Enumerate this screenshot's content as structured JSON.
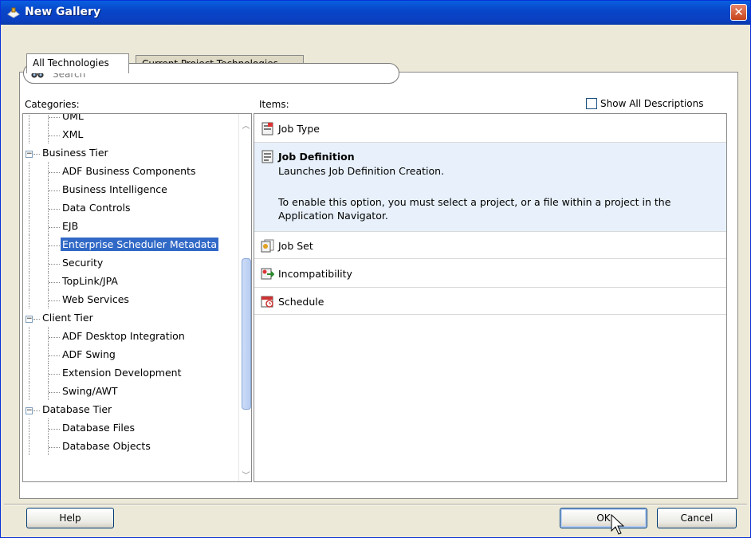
{
  "window": {
    "title": "New Gallery",
    "close_label": "✕"
  },
  "tabs": [
    {
      "label": "All Technologies",
      "active": true
    },
    {
      "label": "Current Project Technologies",
      "active": false
    }
  ],
  "search": {
    "placeholder": "Search",
    "value": ""
  },
  "categories": {
    "label": "Categories:",
    "items": [
      {
        "label": "UML",
        "level": 2,
        "partial": true
      },
      {
        "label": "XML",
        "level": 2
      },
      {
        "label": "Business Tier",
        "level": 1,
        "expanded": true
      },
      {
        "label": "ADF Business Components",
        "level": 2
      },
      {
        "label": "Business Intelligence",
        "level": 2
      },
      {
        "label": "Data Controls",
        "level": 2
      },
      {
        "label": "EJB",
        "level": 2
      },
      {
        "label": "Enterprise Scheduler Metadata",
        "level": 2,
        "selected": true
      },
      {
        "label": "Security",
        "level": 2
      },
      {
        "label": "TopLink/JPA",
        "level": 2
      },
      {
        "label": "Web Services",
        "level": 2
      },
      {
        "label": "Client Tier",
        "level": 1,
        "expanded": true
      },
      {
        "label": "ADF Desktop Integration",
        "level": 2
      },
      {
        "label": "ADF Swing",
        "level": 2
      },
      {
        "label": "Extension Development",
        "level": 2
      },
      {
        "label": "Swing/AWT",
        "level": 2
      },
      {
        "label": "Database Tier",
        "level": 1,
        "expanded": true
      },
      {
        "label": "Database Files",
        "level": 2
      },
      {
        "label": "Database Objects",
        "level": 2
      }
    ]
  },
  "items": {
    "label": "Items:",
    "show_all_label": "Show All Descriptions",
    "show_all_checked": false,
    "list": [
      {
        "label": "Job Type",
        "icon": "job-type-icon"
      },
      {
        "label": "Job Definition",
        "icon": "job-definition-icon",
        "expanded": true,
        "desc1": "Launches Job Definition Creation.",
        "desc2": "To enable this option, you must select a project, or a file within a project in the Application Navigator."
      },
      {
        "label": "Job Set",
        "icon": "job-set-icon"
      },
      {
        "label": "Incompatibility",
        "icon": "incompatibility-icon"
      },
      {
        "label": "Schedule",
        "icon": "schedule-icon"
      }
    ]
  },
  "buttons": {
    "help": "Help",
    "ok": "OK",
    "cancel": "Cancel"
  },
  "colors": {
    "selection": "#3169c6",
    "expanded_item_bg": "#e8f1fb",
    "titlebar": "#0846c9"
  }
}
